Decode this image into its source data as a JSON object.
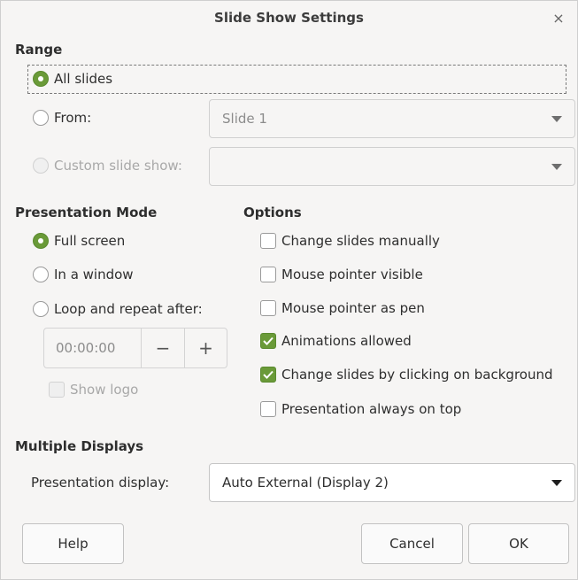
{
  "dialog": {
    "title": "Slide Show Settings",
    "close_glyph": "×"
  },
  "range": {
    "heading": "Range",
    "all_slides": "All slides",
    "from": "From:",
    "from_value": "Slide 1",
    "custom": "Custom slide show:",
    "custom_value": ""
  },
  "mode": {
    "heading": "Presentation Mode",
    "full_screen": "Full screen",
    "in_window": "In a window",
    "loop": "Loop and repeat after:",
    "loop_time": "00:00:00",
    "minus": "−",
    "plus": "+",
    "show_logo": "Show logo"
  },
  "options": {
    "heading": "Options",
    "items": [
      {
        "label": "Change slides manually",
        "checked": false
      },
      {
        "label": "Mouse pointer visible",
        "checked": false
      },
      {
        "label": "Mouse pointer as pen",
        "checked": false
      },
      {
        "label": "Animations allowed",
        "checked": true
      },
      {
        "label": "Change slides by clicking on background",
        "checked": true
      },
      {
        "label": "Presentation always on top",
        "checked": false
      }
    ]
  },
  "displays": {
    "heading": "Multiple Displays",
    "label": "Presentation display:",
    "value": "Auto External (Display 2)"
  },
  "buttons": {
    "help": "Help",
    "cancel": "Cancel",
    "ok": "OK"
  },
  "colors": {
    "accent": "#6a9a38",
    "background": "#f6f5f4"
  }
}
